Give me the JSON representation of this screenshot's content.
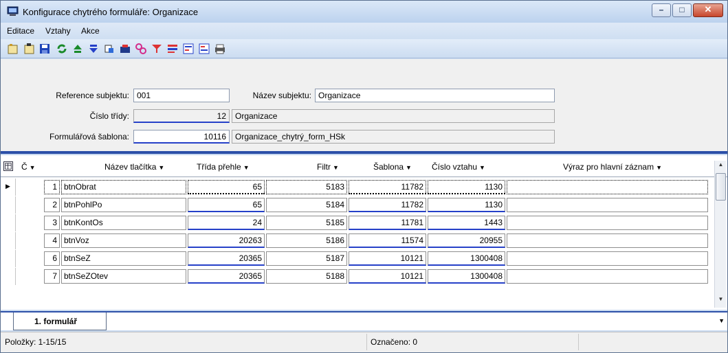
{
  "window": {
    "title": "Konfigurace chytrého formuláře: Organizace",
    "controls": {
      "minimize": "–",
      "maximize": "□",
      "close": "✕"
    }
  },
  "menu": [
    "Editace",
    "Vztahy",
    "Akce"
  ],
  "toolbar": {
    "icons": [
      "new-record-icon",
      "copy-record-icon",
      "save-icon",
      "refresh-icon",
      "move-up-icon",
      "move-down-icon",
      "insert-icon",
      "open-icon",
      "link-icon",
      "filter-icon",
      "filter-add-icon",
      "sort-icon",
      "sort-desc-icon",
      "print-icon"
    ]
  },
  "form": {
    "reference_label": "Reference subjektu:",
    "reference_value": "001",
    "nazev_label": "Název subjektu:",
    "nazev_value": "Organizace",
    "cislo_label": "Číslo třídy:",
    "cislo_value": "12",
    "cislo_name": "Organizace",
    "sablona_label": "Formulářová šablona:",
    "sablona_value": "10116",
    "sablona_name": "Organizace_chytrý_form_HSk"
  },
  "grid": {
    "columns": [
      "Č",
      "Název tlačítka",
      "Třída přehle",
      "Filtr",
      "Šablona",
      "Číslo vztahu",
      "Výraz pro hlavní záznam"
    ],
    "rows": [
      {
        "c": "1",
        "nazev": "btnObrat",
        "trida": "65",
        "filtr": "5183",
        "sablona": "11782",
        "vztah": "1130",
        "vyraz": ""
      },
      {
        "c": "2",
        "nazev": "btnPohlPo",
        "trida": "65",
        "filtr": "5184",
        "sablona": "11782",
        "vztah": "1130",
        "vyraz": ""
      },
      {
        "c": "3",
        "nazev": "btnKontOs",
        "trida": "24",
        "filtr": "5185",
        "sablona": "11781",
        "vztah": "1443",
        "vyraz": ""
      },
      {
        "c": "4",
        "nazev": "btnVoz",
        "trida": "20263",
        "filtr": "5186",
        "sablona": "11574",
        "vztah": "20955",
        "vyraz": ""
      },
      {
        "c": "6",
        "nazev": "btnSeZ",
        "trida": "20365",
        "filtr": "5187",
        "sablona": "10121",
        "vztah": "1300408",
        "vyraz": ""
      },
      {
        "c": "7",
        "nazev": "btnSeZOtev",
        "trida": "20365",
        "filtr": "5188",
        "sablona": "10121",
        "vztah": "1300408",
        "vyraz": ""
      }
    ],
    "current_row_marker": "▶"
  },
  "tabs": [
    "1. formulář"
  ],
  "status": {
    "items": "Položky: 1-15/15",
    "marked": "Označeno: 0"
  }
}
